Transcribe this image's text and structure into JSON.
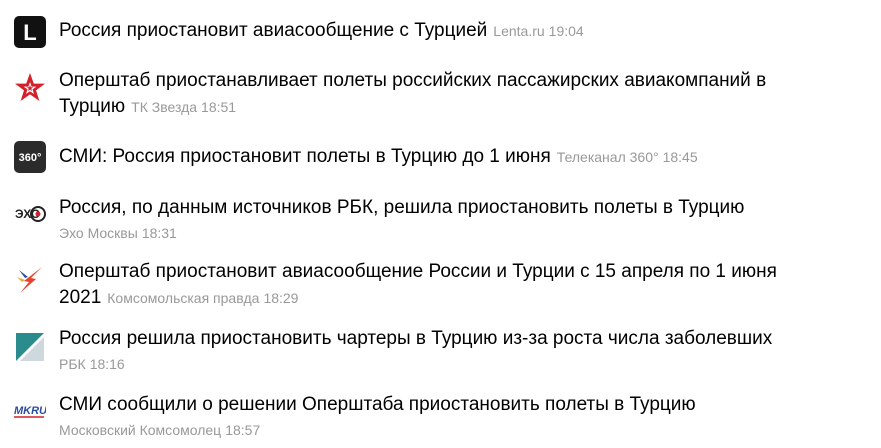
{
  "news": [
    {
      "headline": "Россия приостановит авиасообщение с Турцией",
      "source": "Lenta.ru",
      "time": "19:04",
      "logo_icon": "lenta-logo-icon"
    },
    {
      "headline": "Оперштаб приостанавливает полеты российских пассажирских авиакомпаний в Турцию",
      "source": "ТК Звезда",
      "time": "18:51",
      "logo_icon": "zvezda-logo-icon"
    },
    {
      "headline": "СМИ: Россия приостановит полеты в Турцию до 1 июня",
      "source": "Телеканал 360°",
      "time": "18:45",
      "logo_icon": "360-logo-icon"
    },
    {
      "headline": "Россия, по данным источников РБК, решила приостановить полеты в Турцию",
      "source": "Эхо Москвы",
      "time": "18:31",
      "logo_icon": "echo-moskvy-logo-icon"
    },
    {
      "headline": "Оперштаб приостановит авиасообщение России и Турции с 15 апреля по 1 июня 2021",
      "source": "Комсомольская правда",
      "time": "18:29",
      "logo_icon": "kp-logo-icon"
    },
    {
      "headline": "Россия решила приостановить чартеры в Турцию из-за роста числа заболевших",
      "source": "РБК",
      "time": "18:16",
      "logo_icon": "rbc-logo-icon"
    },
    {
      "headline": "СМИ сообщили о решении Оперштаба приостановить полеты в Турцию",
      "source": "Московский Комсомолец",
      "time": "18:57",
      "logo_icon": "mk-logo-icon"
    }
  ],
  "logos": {
    "lenta_letter": "L",
    "tv360_text": "360°",
    "echo_text": "ЭХО",
    "mk_text": "MKRU"
  },
  "colors": {
    "headline": "#000000",
    "meta": "#999999",
    "zvezda_red": "#d4202a",
    "rbc_teal": "#2a8c8c",
    "kp_red": "#e8412c"
  }
}
